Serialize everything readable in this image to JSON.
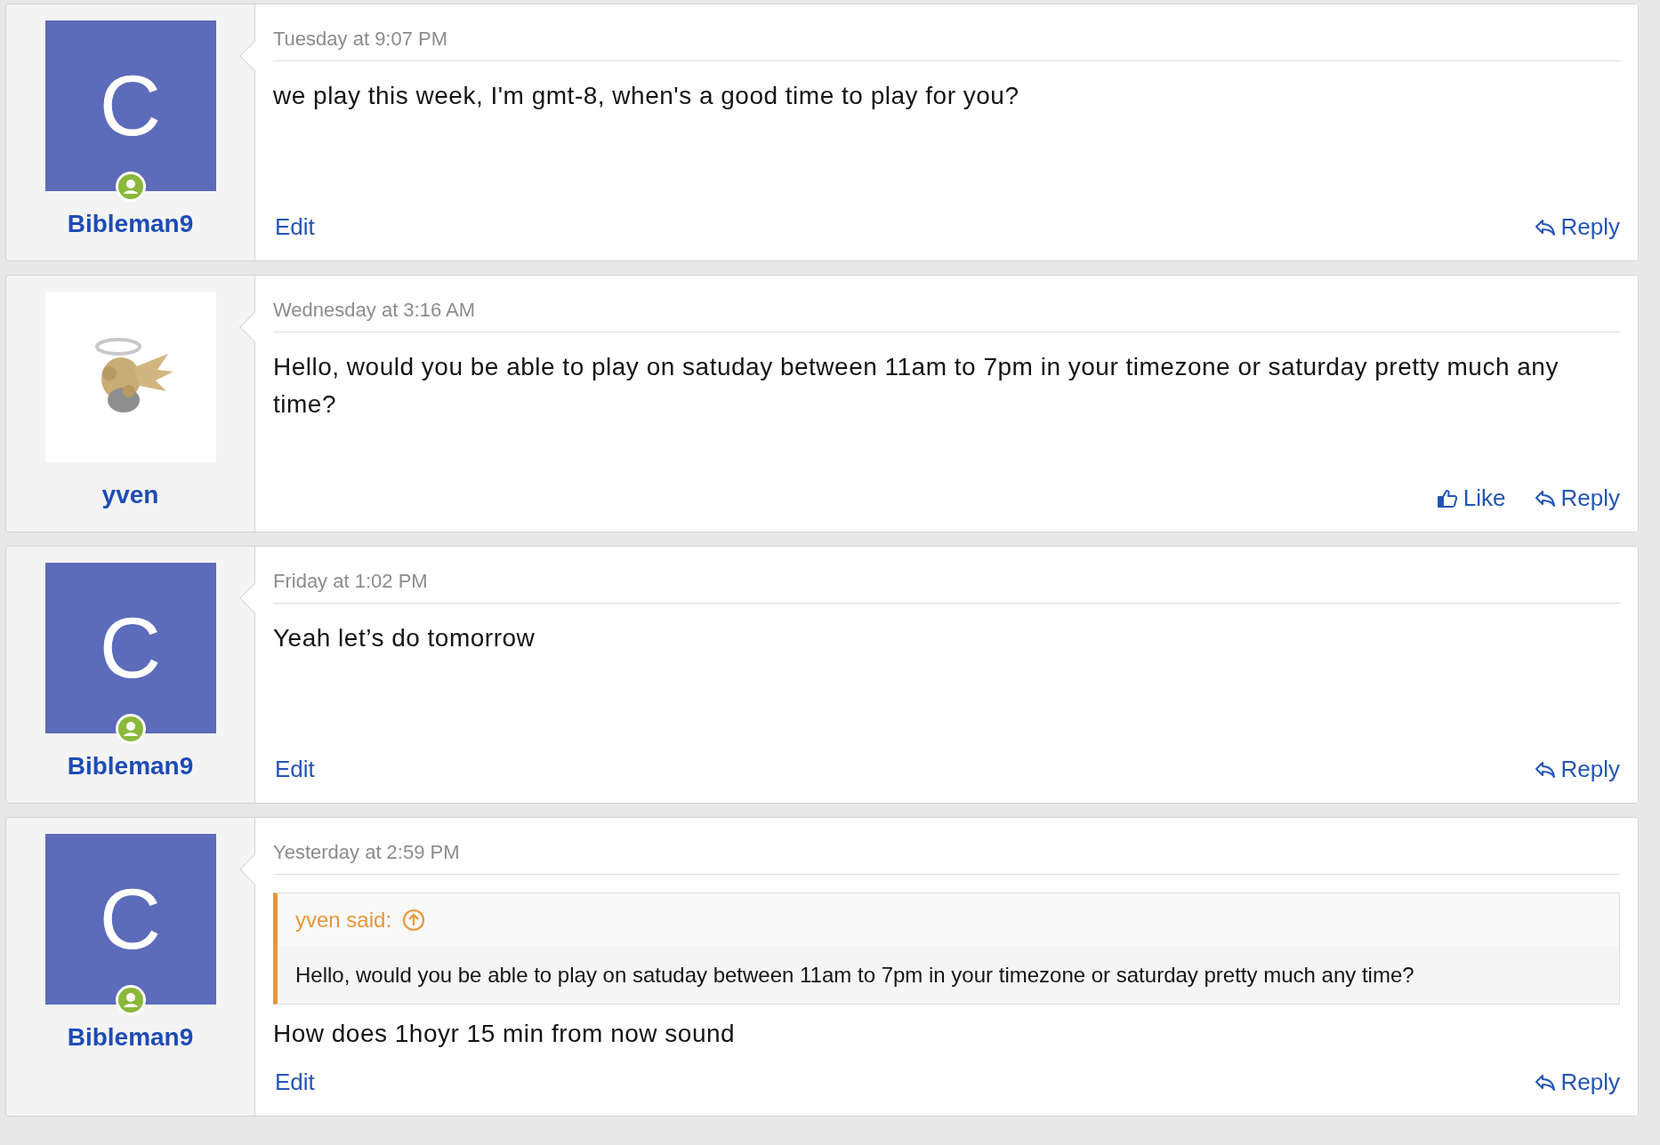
{
  "posts": [
    {
      "author": {
        "name": "Bibleman9",
        "avatar": {
          "kind": "letter",
          "letter": "C"
        },
        "online": true
      },
      "date": "Tuesday at 9:07 PM",
      "message": "we play this week, I'm gmt-8, when's a good time to play for you?",
      "actions": [
        {
          "kind": "edit",
          "label": "Edit"
        },
        {
          "kind": "reply",
          "label": "Reply"
        }
      ]
    },
    {
      "author": {
        "name": "yven",
        "online": false
      },
      "date": "Wednesday at 3:16 AM",
      "message": "Hello, would you be able to play on satuday between 11am to 7pm in your timezone or saturday pretty much any time?",
      "actions": [
        {
          "kind": "like",
          "label": "Like"
        },
        {
          "kind": "reply",
          "label": "Reply"
        }
      ]
    },
    {
      "author": {
        "name": "Bibleman9",
        "avatar": {
          "kind": "letter",
          "letter": "C"
        },
        "online": true
      },
      "date": "Friday at 1:02 PM",
      "message": "Yeah let’s do tomorrow",
      "actions": [
        {
          "kind": "edit",
          "label": "Edit"
        },
        {
          "kind": "reply",
          "label": "Reply"
        }
      ]
    },
    {
      "author": {
        "name": "Bibleman9",
        "avatar": {
          "kind": "letter",
          "letter": "C"
        },
        "online": true
      },
      "date": "Yesterday at 2:59 PM",
      "quote": {
        "author": "yven said:",
        "text": "Hello, would you be able to play on satuday between 11am to 7pm in your timezone or saturday pretty much any time?"
      },
      "message": "How does 1hoyr 15 min from now sound",
      "actions": [
        {
          "kind": "edit",
          "label": "Edit"
        },
        {
          "kind": "reply",
          "label": "Reply"
        }
      ]
    }
  ]
}
